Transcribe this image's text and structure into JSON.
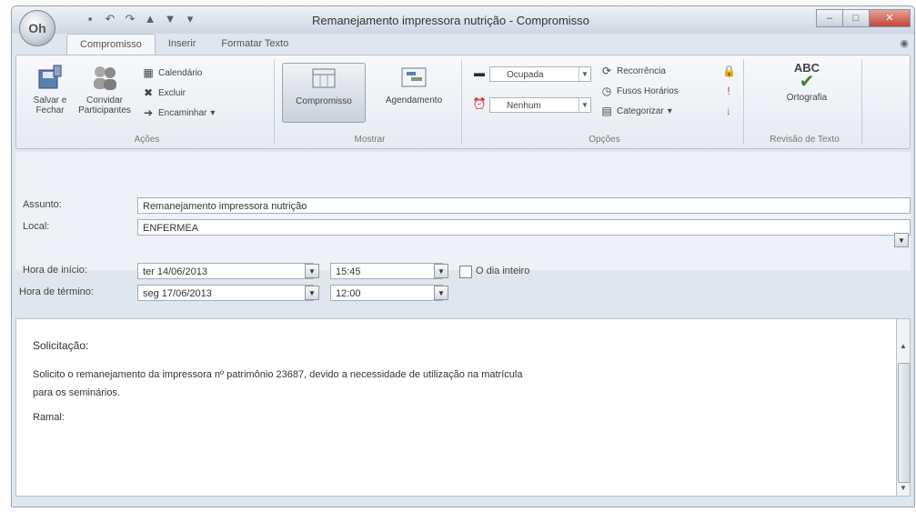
{
  "window": {
    "title": "Remanejamento impressora nutrição - Compromisso",
    "orb_label": "Oh"
  },
  "ribbon": {
    "tabs": [
      "Compromisso",
      "Inserir",
      "Formatar Texto"
    ],
    "groups": {
      "acoes": {
        "label": "Ações",
        "save_close": "Salvar e Fechar",
        "invite": "Convidar Participantes",
        "calendar": "Calendário",
        "delete": "Excluir",
        "forward": "Encaminhar"
      },
      "mostrar": {
        "label": "Mostrar",
        "appointment": "Compromisso",
        "scheduling": "Agendamento"
      },
      "opcoes": {
        "label": "Opções",
        "show_as": "Ocupada",
        "reminder": "Nenhum",
        "recurrence": "Recorrência",
        "time_zones": "Fusos Horários",
        "categorize": "Categorizar"
      },
      "revisao": {
        "label": "Revisão de Texto",
        "spelling": "Ortografia",
        "abc": "ABC"
      }
    }
  },
  "form": {
    "subject_label": "Assunto:",
    "subject_value": "Remanejamento impressora nutrição",
    "location_label": "Local:",
    "location_value": "ENFERMEA",
    "start_label": "Hora de início:",
    "start_date": "ter 14/06/2013",
    "start_time": "15:45",
    "allday_label": "O dia inteiro",
    "end_label": "Hora de término:",
    "end_date": "seg 17/06/2013",
    "end_time": "12:00"
  },
  "body": {
    "line1": "Solicitação:",
    "line2": "Solicito o remanejamento da impressora nº patrimônio 23687, devido a necessidade de utilização na matrícula",
    "line3": "para os seminários.",
    "line4": "Ramal:"
  }
}
